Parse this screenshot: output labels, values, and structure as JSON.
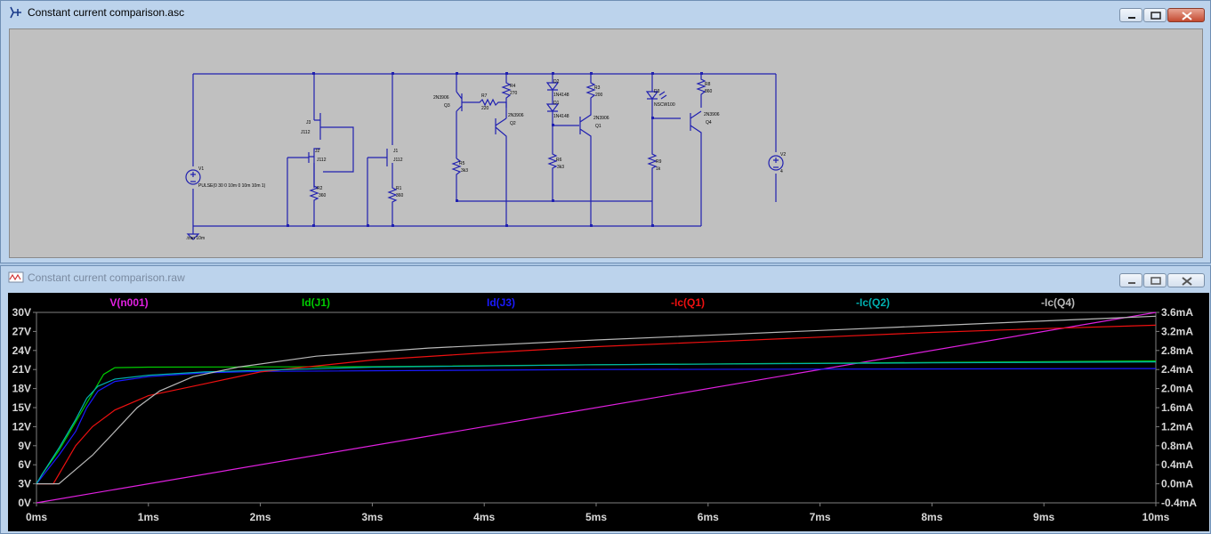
{
  "schematic_window": {
    "title": "Constant current comparison.asc",
    "components": {
      "V1": {
        "name": "V1",
        "value": "PULSE(0 30 0 10m 0 10m 10m 1)"
      },
      "V2": {
        "name": "V2",
        "value": "4"
      },
      "J1": {
        "name": "J1",
        "model": "J112"
      },
      "J2": {
        "name": "J2",
        "model": "J112"
      },
      "J3": {
        "name": "J3",
        "model": "J112"
      },
      "R1": {
        "name": "R1",
        "value": "360"
      },
      "R2": {
        "name": "R2",
        "value": "360"
      },
      "R3": {
        "name": "R3",
        "value": "200"
      },
      "R4": {
        "name": "R4",
        "value": "270"
      },
      "R5": {
        "name": "R5",
        "value": "3k3"
      },
      "R6": {
        "name": "R6",
        "value": "3k3"
      },
      "R7": {
        "name": "R7",
        "value": "220"
      },
      "R8": {
        "name": "R8",
        "value": "860"
      },
      "R9": {
        "name": "R9",
        "value": "1k"
      },
      "Q1": {
        "name": "Q1",
        "model": "2N3906"
      },
      "Q2": {
        "name": "Q2",
        "model": "2N3906"
      },
      "Q3": {
        "name": "Q3",
        "model": "2N3906"
      },
      "Q4": {
        "name": "Q4",
        "model": "2N3906"
      },
      "D1": {
        "name": "D1",
        "model": "1N4148"
      },
      "D2": {
        "name": "D2",
        "model": "1N4148"
      },
      "D3": {
        "name": "D3",
        "model": "NSCW100"
      },
      "directive": ".tran 10m"
    }
  },
  "waveform_window": {
    "title": "Constant current comparison.raw"
  },
  "chart_data": {
    "type": "line",
    "title": "",
    "xlabel": "",
    "ylabel": "",
    "x_ticks": [
      "0ms",
      "1ms",
      "2ms",
      "3ms",
      "4ms",
      "5ms",
      "6ms",
      "7ms",
      "8ms",
      "9ms",
      "10ms"
    ],
    "y_left_ticks": [
      "0V",
      "3V",
      "6V",
      "9V",
      "12V",
      "15V",
      "18V",
      "21V",
      "24V",
      "27V",
      "30V"
    ],
    "y_right_ticks": [
      "-0.4mA",
      "0.0mA",
      "0.4mA",
      "0.8mA",
      "1.2mA",
      "1.6mA",
      "2.0mA",
      "2.4mA",
      "2.8mA",
      "3.2mA",
      "3.6mA"
    ],
    "x_range_ms": [
      0,
      10
    ],
    "y_left_range_V": [
      0,
      30
    ],
    "y_right_range_mA": [
      -0.4,
      3.6
    ],
    "grid": false,
    "background": "#000000",
    "series": [
      {
        "name": "V(n001)",
        "axis": "left",
        "color": "#e020e0",
        "points": [
          [
            0,
            0
          ],
          [
            10,
            30
          ]
        ]
      },
      {
        "name": "Id(J1)",
        "axis": "right",
        "color": "#00cc00",
        "points": [
          [
            0,
            0.0
          ],
          [
            0.05,
            0.2
          ],
          [
            0.2,
            0.7
          ],
          [
            0.35,
            1.3
          ],
          [
            0.5,
            1.9
          ],
          [
            0.6,
            2.3
          ],
          [
            0.7,
            2.44
          ],
          [
            1,
            2.45
          ],
          [
            3,
            2.46
          ],
          [
            5,
            2.5
          ],
          [
            8,
            2.55
          ],
          [
            10,
            2.58
          ]
        ]
      },
      {
        "name": "Id(J3)",
        "axis": "right",
        "color": "#1a1aff",
        "points": [
          [
            0,
            0.0
          ],
          [
            0.05,
            0.15
          ],
          [
            0.2,
            0.6
          ],
          [
            0.35,
            1.1
          ],
          [
            0.45,
            1.6
          ],
          [
            0.55,
            1.95
          ],
          [
            0.7,
            2.15
          ],
          [
            1,
            2.25
          ],
          [
            1.5,
            2.33
          ],
          [
            2,
            2.36
          ],
          [
            5,
            2.4
          ],
          [
            10,
            2.42
          ]
        ]
      },
      {
        "name": "-Ic(Q1)",
        "axis": "right",
        "color": "#ee1010",
        "points": [
          [
            0,
            0.0
          ],
          [
            0.15,
            0.0
          ],
          [
            0.25,
            0.4
          ],
          [
            0.35,
            0.8
          ],
          [
            0.5,
            1.2
          ],
          [
            0.7,
            1.55
          ],
          [
            1,
            1.85
          ],
          [
            1.5,
            2.1
          ],
          [
            2,
            2.35
          ],
          [
            3,
            2.6
          ],
          [
            4,
            2.75
          ],
          [
            5,
            2.88
          ],
          [
            6,
            2.98
          ],
          [
            7,
            3.08
          ],
          [
            8,
            3.18
          ],
          [
            9,
            3.26
          ],
          [
            10,
            3.33
          ]
        ]
      },
      {
        "name": "-Ic(Q2)",
        "axis": "right",
        "color": "#00b0b0",
        "points": [
          [
            0,
            0.0
          ],
          [
            0.05,
            0.2
          ],
          [
            0.2,
            0.75
          ],
          [
            0.35,
            1.35
          ],
          [
            0.45,
            1.8
          ],
          [
            0.55,
            2.05
          ],
          [
            0.7,
            2.2
          ],
          [
            1,
            2.28
          ],
          [
            1.5,
            2.35
          ],
          [
            3,
            2.45
          ],
          [
            5,
            2.5
          ],
          [
            8,
            2.54
          ],
          [
            10,
            2.56
          ]
        ]
      },
      {
        "name": "-Ic(Q4)",
        "axis": "right",
        "color": "#b8b8b8",
        "points": [
          [
            0,
            0.0
          ],
          [
            0.2,
            0.0
          ],
          [
            0.3,
            0.2
          ],
          [
            0.5,
            0.6
          ],
          [
            0.7,
            1.1
          ],
          [
            0.9,
            1.6
          ],
          [
            1.1,
            1.95
          ],
          [
            1.4,
            2.25
          ],
          [
            1.8,
            2.45
          ],
          [
            2.5,
            2.68
          ],
          [
            3.5,
            2.85
          ],
          [
            5,
            3.02
          ],
          [
            6,
            3.12
          ],
          [
            7,
            3.22
          ],
          [
            8,
            3.32
          ],
          [
            9,
            3.42
          ],
          [
            10,
            3.52
          ]
        ]
      }
    ]
  }
}
